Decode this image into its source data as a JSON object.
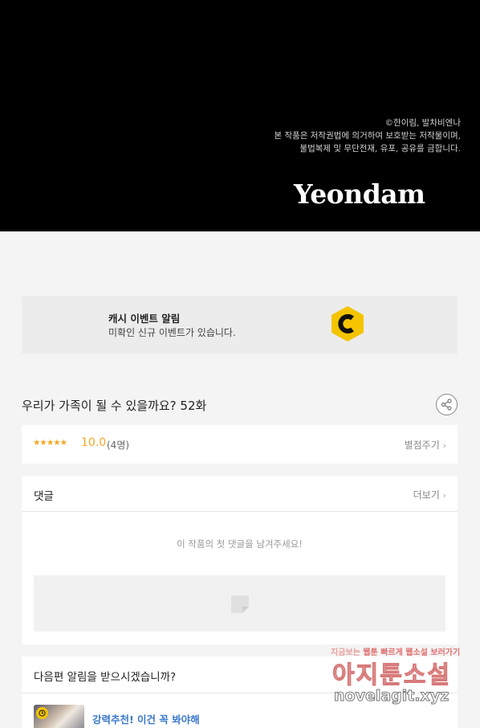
{
  "hero": {
    "copyright_lines": [
      "©한이림, 발차비엔나",
      "본 작품은 저작권법에 의거하여 보호받는 저작물이며,",
      "불법복제 및 무단전재, 유포, 공유를 금합니다."
    ],
    "brand": "Yeondam"
  },
  "cash_event": {
    "title": "캐시 이벤트 알림",
    "subtitle": "미확인 신규 이벤트가 있습니다.",
    "icon": "coin-c-icon",
    "icon_color": "#f5c400"
  },
  "episode": {
    "title": "우리가 가족이 될 수 있을까요? 52화",
    "share_icon": "share-icon"
  },
  "rating": {
    "stars": "★★★★★",
    "score": "10.0",
    "count": "(4명)",
    "rate_link": "별점주기",
    "star_color": "#f5a623"
  },
  "comments": {
    "header": "댓글",
    "more_link": "더보기",
    "empty_message": "이 작품의 첫 댓글을 남겨주세요!"
  },
  "next_episode": {
    "question": "다음편 알림을 받으시겠습니까?",
    "promo_text": "강력추천! 이건 꼭 봐야해",
    "promo_color": "#3a78c9"
  },
  "watermark": {
    "top_prefix": "지금보는",
    "top_a": "웹툰",
    "top_b": "빠르게",
    "top_c": "웹소설",
    "top_d": "보러가기",
    "main": "아지툰소설",
    "url": "novelagit.xyz"
  }
}
